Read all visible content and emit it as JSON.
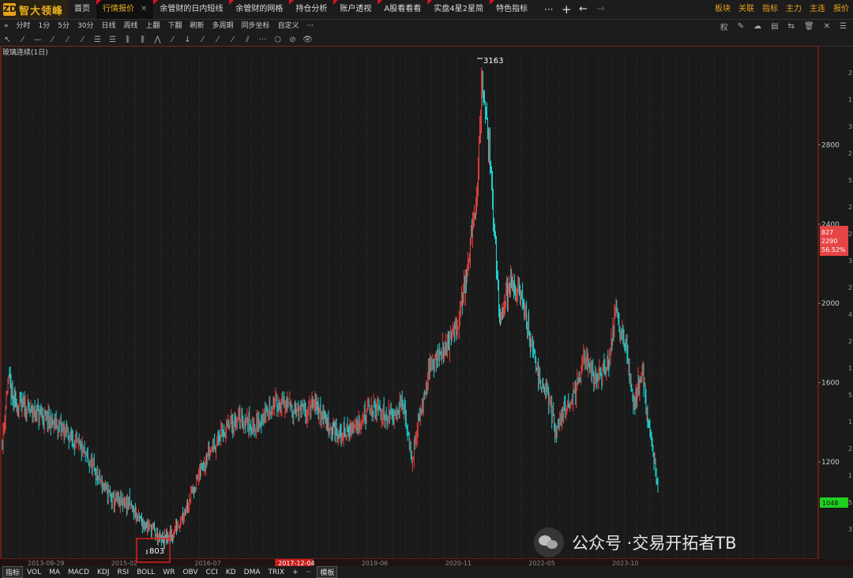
{
  "app": {
    "logo_icon": "ZD",
    "name": "智大领峰"
  },
  "tabs": [
    {
      "label": "首页"
    },
    {
      "label": "行情报价",
      "active": true,
      "closable": true
    },
    {
      "label": "余管财的日内短线"
    },
    {
      "label": "余管财的网格"
    },
    {
      "label": "持仓分析"
    },
    {
      "label": "账户透视"
    },
    {
      "label": "A股看看看"
    },
    {
      "label": "实盘4星2星简"
    },
    {
      "label": "特色指标"
    }
  ],
  "tab_controls": {
    "more": "···",
    "add": "+",
    "back": "←",
    "forward": "→"
  },
  "top_right": [
    "板块",
    "关联",
    "指标",
    "主力",
    "主连",
    "报价"
  ],
  "periods": [
    "»",
    "分时",
    "1分",
    "5分",
    "30分",
    "日线",
    "周线",
    "上翻",
    "下翻",
    "刷新",
    "多周期",
    "同步坐标",
    "自定义",
    "···"
  ],
  "toolbar_right_icons": [
    "权",
    "✎",
    "☁",
    "▤",
    "⇆",
    "🗑",
    "✕",
    "☰"
  ],
  "draw_tools": [
    "↖",
    "⁄",
    "—",
    "⁄",
    "⁄",
    "⁄",
    "☰",
    "☰",
    "⫼",
    "⫼",
    "⋀",
    "⁄",
    "↓",
    "⁄",
    "⁄",
    "⁄",
    "⫽",
    "···",
    "⬡",
    "⊘",
    "👁"
  ],
  "chart_title": "玻璃连续(1日)",
  "chart_data": {
    "type": "candlestick",
    "title": "玻璃连续(1日)",
    "x_labels": [
      "2013-08-29",
      "2015-02",
      "2016-07",
      "2017-12-04",
      "2019-06",
      "2020-11",
      "2022-05",
      "2023-10"
    ],
    "y_ticks": [
      1200,
      1600,
      2000,
      2400,
      2800
    ],
    "ylim": [
      730,
      3260
    ],
    "annotations": {
      "high": "3163",
      "low": "803"
    },
    "price_tags": [
      {
        "lines": [
          "827",
          "2290",
          "56.52%"
        ],
        "color": "#e64545"
      },
      {
        "lines": [
          "1048"
        ],
        "color": "#1ed11e"
      }
    ],
    "y_right_partial": [
      "2",
      "1",
      "3",
      "2",
      "5",
      "2",
      "2",
      "3",
      "2",
      "4",
      "2",
      "1",
      "5",
      "1",
      "2",
      "1",
      "5",
      "3"
    ],
    "keypoints": [
      [
        0,
        1300
      ],
      [
        7,
        1620
      ],
      [
        14,
        1500
      ],
      [
        35,
        1460
      ],
      [
        55,
        1420
      ],
      [
        78,
        1360
      ],
      [
        100,
        1260
      ],
      [
        120,
        1130
      ],
      [
        140,
        1000
      ],
      [
        160,
        990
      ],
      [
        175,
        900
      ],
      [
        190,
        860
      ],
      [
        200,
        803
      ],
      [
        215,
        830
      ],
      [
        230,
        960
      ],
      [
        245,
        1100
      ],
      [
        260,
        1250
      ],
      [
        280,
        1360
      ],
      [
        300,
        1420
      ],
      [
        320,
        1380
      ],
      [
        345,
        1500
      ],
      [
        360,
        1480
      ],
      [
        380,
        1450
      ],
      [
        395,
        1480
      ],
      [
        410,
        1400
      ],
      [
        425,
        1330
      ],
      [
        445,
        1380
      ],
      [
        465,
        1470
      ],
      [
        490,
        1430
      ],
      [
        505,
        1500
      ],
      [
        518,
        1200
      ],
      [
        525,
        1400
      ],
      [
        540,
        1690
      ],
      [
        560,
        1780
      ],
      [
        575,
        1880
      ],
      [
        590,
        2250
      ],
      [
        600,
        2600
      ],
      [
        606,
        3163
      ],
      [
        612,
        2900
      ],
      [
        618,
        2600
      ],
      [
        624,
        2200
      ],
      [
        628,
        1900
      ],
      [
        640,
        2100
      ],
      [
        655,
        2050
      ],
      [
        668,
        1800
      ],
      [
        680,
        1600
      ],
      [
        690,
        1520
      ],
      [
        700,
        1350
      ],
      [
        712,
        1480
      ],
      [
        725,
        1560
      ],
      [
        735,
        1720
      ],
      [
        750,
        1620
      ],
      [
        765,
        1700
      ],
      [
        775,
        1970
      ],
      [
        787,
        1800
      ],
      [
        797,
        1480
      ],
      [
        808,
        1680
      ],
      [
        815,
        1400
      ],
      [
        822,
        1250
      ],
      [
        828,
        1048
      ]
    ]
  },
  "indicators": [
    "指标",
    "VOL",
    "MA",
    "MACD",
    "KDJ",
    "RSI",
    "BOLL",
    "WR",
    "OBV",
    "CCI",
    "KD",
    "DMA",
    "TRIX",
    "+",
    "··",
    "模板"
  ],
  "watermark": {
    "prefix": "公众号 · ",
    "name": "交易开拓者TB"
  }
}
